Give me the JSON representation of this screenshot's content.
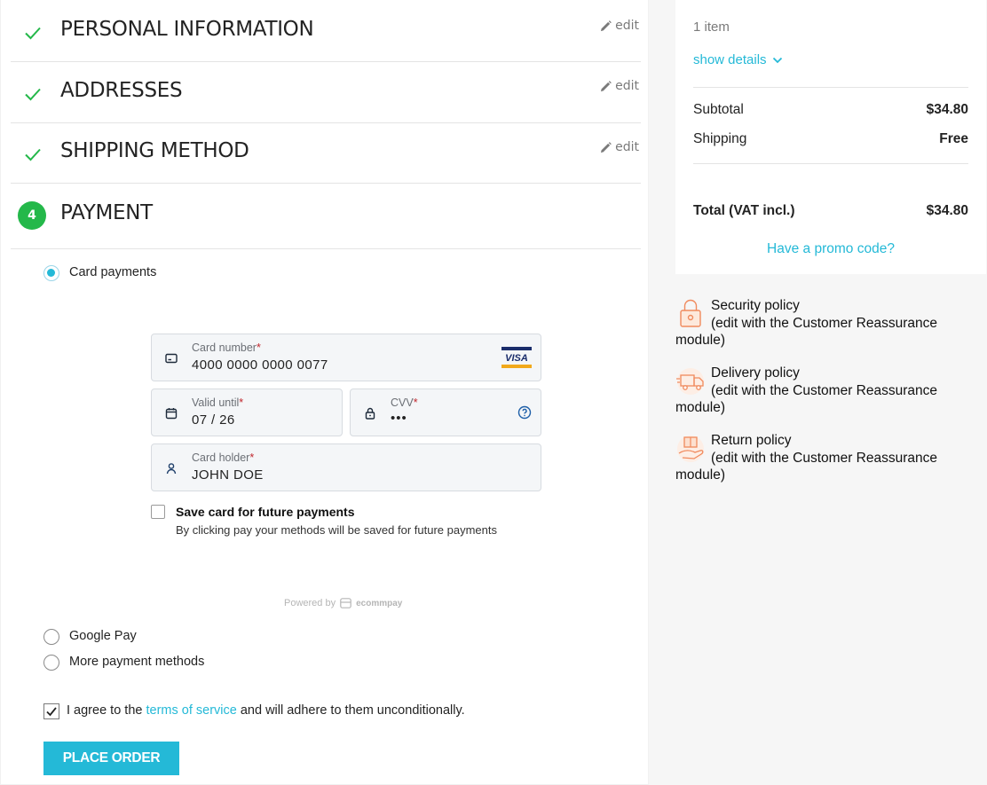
{
  "steps": [
    {
      "title": "PERSONAL INFORMATION",
      "edit": "edit"
    },
    {
      "title": "ADDRESSES",
      "edit": "edit"
    },
    {
      "title": "SHIPPING METHOD",
      "edit": "edit"
    },
    {
      "number": "4",
      "title": "PAYMENT"
    }
  ],
  "payment": {
    "options": [
      {
        "label": "Card payments",
        "selected": true
      },
      {
        "label": "Google Pay",
        "selected": false
      },
      {
        "label": "More payment methods",
        "selected": false
      }
    ],
    "card_form": {
      "card_number": {
        "label": "Card number",
        "required": "*",
        "value": "4000 0000 0000 0077"
      },
      "valid_until": {
        "label": "Valid until",
        "required": "*",
        "value": "07 / 26"
      },
      "cvv": {
        "label": "CVV",
        "required": "*",
        "value": "•••"
      },
      "card_holder": {
        "label": "Card holder",
        "required": "*",
        "value": "JOHN DOE"
      },
      "card_brand": "VISA",
      "save_card": {
        "title": "Save card for future payments",
        "description": "By clicking pay your methods will be saved for future payments"
      },
      "powered_by": "Powered by",
      "provider": "ecommpay"
    },
    "terms": {
      "prefix": "I agree to the ",
      "link": "terms of service",
      "suffix": " and will adhere to them unconditionally."
    },
    "place_order_label": "PLACE ORDER"
  },
  "summary": {
    "items_count": "1 item",
    "show_details": "show details",
    "subtotal_label": "Subtotal",
    "subtotal_value": "$34.80",
    "shipping_label": "Shipping",
    "shipping_value": "Free",
    "total_label": "Total (VAT incl.)",
    "total_value": "$34.80",
    "promo_label": "Have a promo code?"
  },
  "reassurance": [
    {
      "title": "Security policy",
      "text": "(edit with the Customer Reassurance module)",
      "icon": "lock-icon"
    },
    {
      "title": "Delivery policy",
      "text": "(edit with the Customer Reassurance module)",
      "icon": "delivery-truck-icon"
    },
    {
      "title": "Return policy",
      "text": "(edit with the Customer Reassurance module)",
      "icon": "return-box-icon"
    }
  ],
  "colors": {
    "accent": "#24b9d7",
    "success": "#24b84a",
    "sidebar_bg": "#f6f6f6"
  }
}
